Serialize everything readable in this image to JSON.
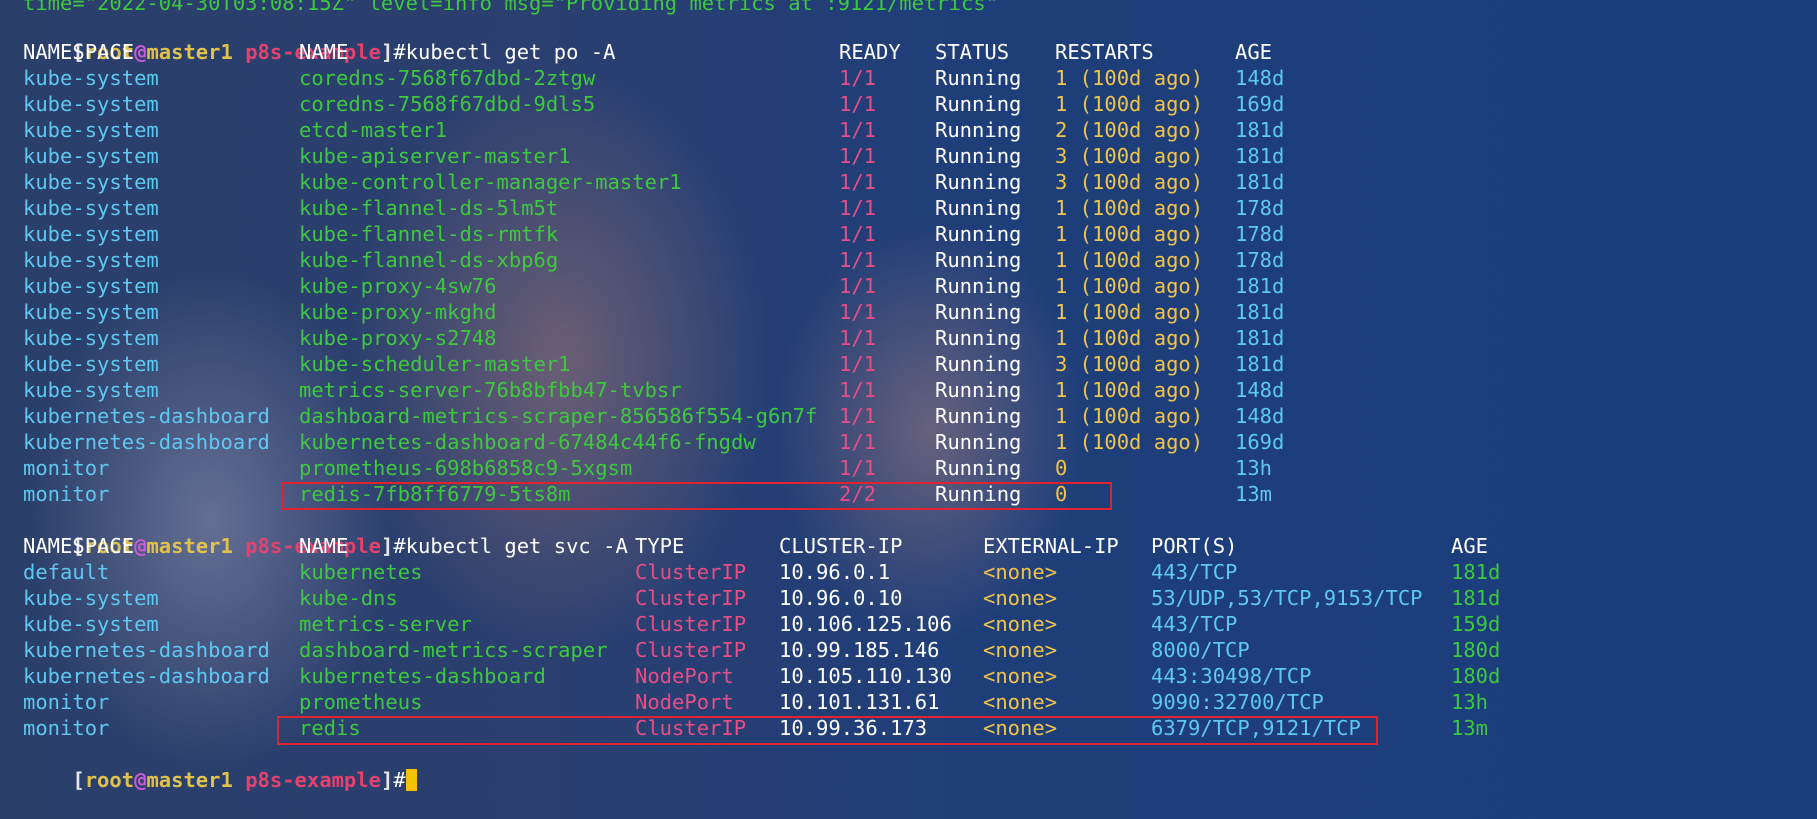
{
  "top_partial": "time=\"2022-04-30T03:08:15Z\" level=info msg=\"Providing metrics at :9121/metrics\"",
  "prompt": {
    "open": "[",
    "user": "root",
    "at": "@",
    "host": "master1",
    "dir": "p8s-example",
    "close": "]",
    "hash": "#"
  },
  "commands": {
    "get_po": "kubectl get po -A",
    "get_svc": "kubectl get svc -A"
  },
  "pods": {
    "headers": {
      "namespace": "NAMESPACE",
      "name": "NAME",
      "ready": "READY",
      "status": "STATUS",
      "restarts": "RESTARTS",
      "age": "AGE"
    },
    "rows": [
      {
        "namespace": "kube-system",
        "name": "coredns-7568f67dbd-2ztgw",
        "ready": "1/1",
        "status": "Running",
        "restarts": "1 (100d ago)",
        "age": "148d"
      },
      {
        "namespace": "kube-system",
        "name": "coredns-7568f67dbd-9dls5",
        "ready": "1/1",
        "status": "Running",
        "restarts": "1 (100d ago)",
        "age": "169d"
      },
      {
        "namespace": "kube-system",
        "name": "etcd-master1",
        "ready": "1/1",
        "status": "Running",
        "restarts": "2 (100d ago)",
        "age": "181d"
      },
      {
        "namespace": "kube-system",
        "name": "kube-apiserver-master1",
        "ready": "1/1",
        "status": "Running",
        "restarts": "3 (100d ago)",
        "age": "181d"
      },
      {
        "namespace": "kube-system",
        "name": "kube-controller-manager-master1",
        "ready": "1/1",
        "status": "Running",
        "restarts": "3 (100d ago)",
        "age": "181d"
      },
      {
        "namespace": "kube-system",
        "name": "kube-flannel-ds-5lm5t",
        "ready": "1/1",
        "status": "Running",
        "restarts": "1 (100d ago)",
        "age": "178d"
      },
      {
        "namespace": "kube-system",
        "name": "kube-flannel-ds-rmtfk",
        "ready": "1/1",
        "status": "Running",
        "restarts": "1 (100d ago)",
        "age": "178d"
      },
      {
        "namespace": "kube-system",
        "name": "kube-flannel-ds-xbp6g",
        "ready": "1/1",
        "status": "Running",
        "restarts": "1 (100d ago)",
        "age": "178d"
      },
      {
        "namespace": "kube-system",
        "name": "kube-proxy-4sw76",
        "ready": "1/1",
        "status": "Running",
        "restarts": "1 (100d ago)",
        "age": "181d"
      },
      {
        "namespace": "kube-system",
        "name": "kube-proxy-mkghd",
        "ready": "1/1",
        "status": "Running",
        "restarts": "1 (100d ago)",
        "age": "181d"
      },
      {
        "namespace": "kube-system",
        "name": "kube-proxy-s2748",
        "ready": "1/1",
        "status": "Running",
        "restarts": "1 (100d ago)",
        "age": "181d"
      },
      {
        "namespace": "kube-system",
        "name": "kube-scheduler-master1",
        "ready": "1/1",
        "status": "Running",
        "restarts": "3 (100d ago)",
        "age": "181d"
      },
      {
        "namespace": "kube-system",
        "name": "metrics-server-76b8bfbb47-tvbsr",
        "ready": "1/1",
        "status": "Running",
        "restarts": "1 (100d ago)",
        "age": "148d"
      },
      {
        "namespace": "kubernetes-dashboard",
        "name": "dashboard-metrics-scraper-856586f554-g6n7f",
        "ready": "1/1",
        "status": "Running",
        "restarts": "1 (100d ago)",
        "age": "148d"
      },
      {
        "namespace": "kubernetes-dashboard",
        "name": "kubernetes-dashboard-67484c44f6-fngdw",
        "ready": "1/1",
        "status": "Running",
        "restarts": "1 (100d ago)",
        "age": "169d"
      },
      {
        "namespace": "monitor",
        "name": "prometheus-698b6858c9-5xgsm",
        "ready": "1/1",
        "status": "Running",
        "restarts": "0",
        "age": "13h"
      },
      {
        "namespace": "monitor",
        "name": "redis-7fb8ff6779-5ts8m",
        "ready": "2/2",
        "status": "Running",
        "restarts": "0",
        "age": "13m"
      }
    ]
  },
  "services": {
    "headers": {
      "namespace": "NAMESPACE",
      "name": "NAME",
      "type": "TYPE",
      "cluster_ip": "CLUSTER-IP",
      "external_ip": "EXTERNAL-IP",
      "ports": "PORT(S)",
      "age": "AGE"
    },
    "rows": [
      {
        "namespace": "default",
        "name": "kubernetes",
        "type": "ClusterIP",
        "cluster_ip": "10.96.0.1",
        "external_ip": "<none>",
        "ports": "443/TCP",
        "age": "181d"
      },
      {
        "namespace": "kube-system",
        "name": "kube-dns",
        "type": "ClusterIP",
        "cluster_ip": "10.96.0.10",
        "external_ip": "<none>",
        "ports": "53/UDP,53/TCP,9153/TCP",
        "age": "181d"
      },
      {
        "namespace": "kube-system",
        "name": "metrics-server",
        "type": "ClusterIP",
        "cluster_ip": "10.106.125.106",
        "external_ip": "<none>",
        "ports": "443/TCP",
        "age": "159d"
      },
      {
        "namespace": "kubernetes-dashboard",
        "name": "dashboard-metrics-scraper",
        "type": "ClusterIP",
        "cluster_ip": "10.99.185.146",
        "external_ip": "<none>",
        "ports": "8000/TCP",
        "age": "180d"
      },
      {
        "namespace": "kubernetes-dashboard",
        "name": "kubernetes-dashboard",
        "type": "NodePort",
        "cluster_ip": "10.105.110.130",
        "external_ip": "<none>",
        "ports": "443:30498/TCP",
        "age": "180d"
      },
      {
        "namespace": "monitor",
        "name": "prometheus",
        "type": "NodePort",
        "cluster_ip": "10.101.131.61",
        "external_ip": "<none>",
        "ports": "9090:32700/TCP",
        "age": "13h"
      },
      {
        "namespace": "monitor",
        "name": "redis",
        "type": "ClusterIP",
        "cluster_ip": "10.99.36.173",
        "external_ip": "<none>",
        "ports": "6379/TCP,9121/TCP",
        "age": "13m"
      }
    ]
  },
  "colors": {
    "highlight_box": "#e0242e",
    "cursor": "#f2c200"
  }
}
